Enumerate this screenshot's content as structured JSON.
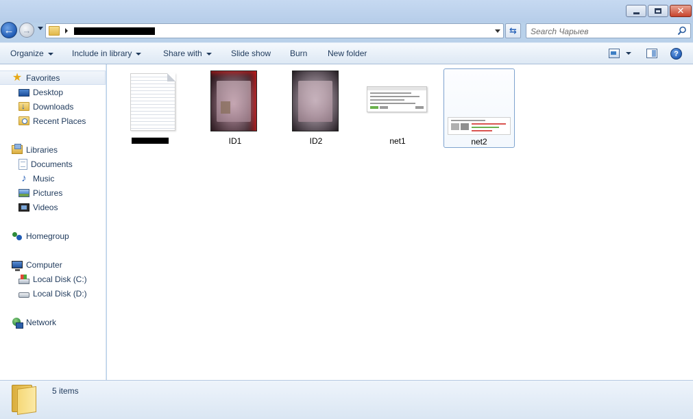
{
  "window": {
    "minimize_glyph": "",
    "maximize_glyph": "",
    "close_glyph": "✕"
  },
  "nav": {
    "back_glyph": "←",
    "forward_glyph": "→",
    "refresh_glyph": "⇆",
    "address_path": "",
    "search_placeholder": "Search Чарыев"
  },
  "toolbar": {
    "items": [
      "Organize",
      "Include in library",
      "Share with",
      "Slide show",
      "Burn",
      "New folder"
    ],
    "help_glyph": "?"
  },
  "sidebar": {
    "favorites": {
      "label": "Favorites",
      "items": [
        "Desktop",
        "Downloads",
        "Recent Places"
      ]
    },
    "libraries": {
      "label": "Libraries",
      "items": [
        "Documents",
        "Music",
        "Pictures",
        "Videos"
      ]
    },
    "homegroup": {
      "label": "Homegroup"
    },
    "computer": {
      "label": "Computer",
      "items": [
        "Local Disk (C:)",
        "Local Disk (D:)"
      ]
    },
    "network": {
      "label": "Network"
    }
  },
  "files": [
    {
      "name": "",
      "kind": "document",
      "name_redacted": true
    },
    {
      "name": "ID1",
      "kind": "photo"
    },
    {
      "name": "ID2",
      "kind": "photo"
    },
    {
      "name": "net1",
      "kind": "screenshot"
    },
    {
      "name": "net2",
      "kind": "screenshot",
      "selected": true
    }
  ],
  "status": {
    "item_count": "5 items"
  },
  "icons": {
    "favorites": "star-icon",
    "desktop": "desktop-icon",
    "downloads": "downloads-icon",
    "recent": "recent-places-icon",
    "libraries": "libraries-icon",
    "documents": "documents-icon",
    "music": "music-icon",
    "pictures": "pictures-icon",
    "videos": "videos-icon",
    "homegroup": "homegroup-icon",
    "computer": "computer-icon",
    "disk_c": "disk-c-icon",
    "disk_d": "disk-d-icon",
    "network": "network-icon"
  },
  "colors": {
    "chrome": "#b9d1ea",
    "text": "#1e395b",
    "selection_border": "#7da2ce",
    "close_button": "#c7432c"
  }
}
